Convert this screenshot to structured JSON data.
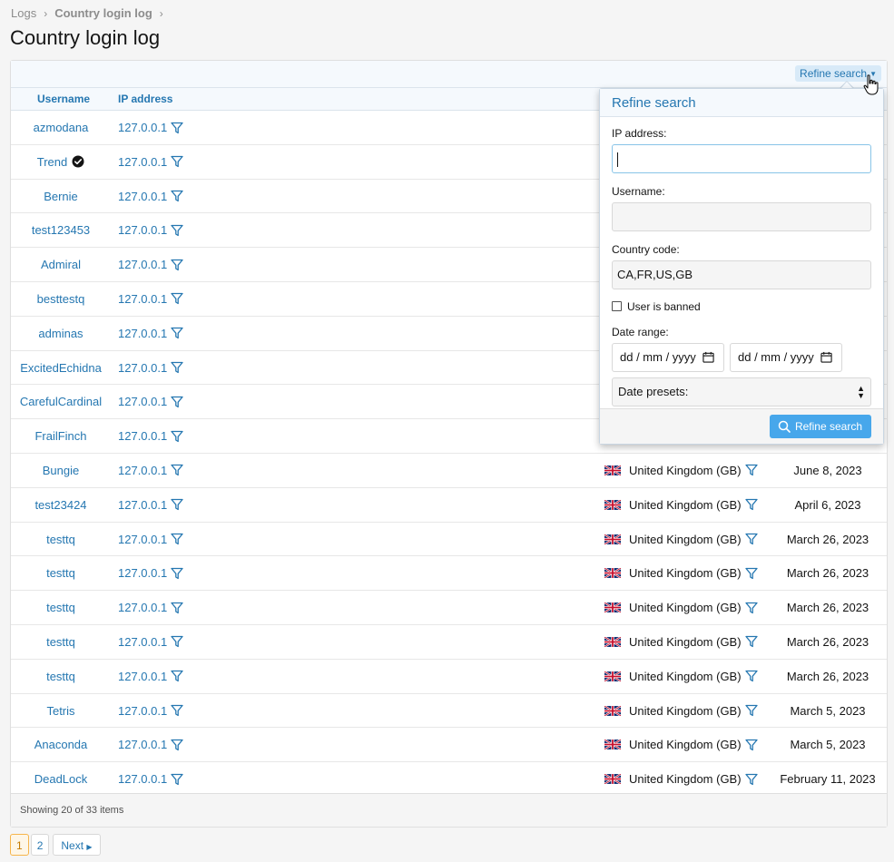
{
  "breadcrumb": {
    "items": [
      "Logs",
      "Country login log"
    ],
    "separator": "›"
  },
  "page_title": "Country login log",
  "toolbar": {
    "refine_label": "Refine search"
  },
  "table": {
    "headers": {
      "username": "Username",
      "ip": "IP address"
    },
    "rows": [
      {
        "username": "azmodana",
        "ip": "127.0.0.1",
        "country": "",
        "date": ""
      },
      {
        "username": "Trend",
        "ip": "127.0.0.1",
        "country": "",
        "date": "",
        "verified": true
      },
      {
        "username": "Bernie",
        "ip": "127.0.0.1",
        "country": "",
        "date": ""
      },
      {
        "username": "test123453",
        "ip": "127.0.0.1",
        "country": "",
        "date": ""
      },
      {
        "username": "Admiral",
        "ip": "127.0.0.1",
        "country": "",
        "date": ""
      },
      {
        "username": "besttestq",
        "ip": "127.0.0.1",
        "country": "",
        "date": ""
      },
      {
        "username": "adminas",
        "ip": "127.0.0.1",
        "country": "",
        "date": ""
      },
      {
        "username": "ExcitedEchidna",
        "ip": "127.0.0.1",
        "country": "",
        "date": ""
      },
      {
        "username": "CarefulCardinal",
        "ip": "127.0.0.1",
        "country": "",
        "date": ""
      },
      {
        "username": "FrailFinch",
        "ip": "127.0.0.1",
        "country": "",
        "date": ""
      },
      {
        "username": "Bungie",
        "ip": "127.0.0.1",
        "country": "United Kingdom (GB)",
        "date": "June 8, 2023"
      },
      {
        "username": "test23424",
        "ip": "127.0.0.1",
        "country": "United Kingdom (GB)",
        "date": "April 6, 2023"
      },
      {
        "username": "testtq",
        "ip": "127.0.0.1",
        "country": "United Kingdom (GB)",
        "date": "March 26, 2023"
      },
      {
        "username": "testtq",
        "ip": "127.0.0.1",
        "country": "United Kingdom (GB)",
        "date": "March 26, 2023"
      },
      {
        "username": "testtq",
        "ip": "127.0.0.1",
        "country": "United Kingdom (GB)",
        "date": "March 26, 2023"
      },
      {
        "username": "testtq",
        "ip": "127.0.0.1",
        "country": "United Kingdom (GB)",
        "date": "March 26, 2023"
      },
      {
        "username": "testtq",
        "ip": "127.0.0.1",
        "country": "United Kingdom (GB)",
        "date": "March 26, 2023"
      },
      {
        "username": "Tetris",
        "ip": "127.0.0.1",
        "country": "United Kingdom (GB)",
        "date": "March 5, 2023"
      },
      {
        "username": "Anaconda",
        "ip": "127.0.0.1",
        "country": "United Kingdom (GB)",
        "date": "March 5, 2023"
      },
      {
        "username": "DeadLock",
        "ip": "127.0.0.1",
        "country": "United Kingdom (GB)",
        "date": "February 11, 2023"
      }
    ]
  },
  "footer": {
    "showing": "Showing 20 of 33 items"
  },
  "pagination": {
    "pages": [
      "1",
      "2"
    ],
    "current": "1",
    "next_label": "Next"
  },
  "refine_popup": {
    "title": "Refine search",
    "ip_label": "IP address:",
    "ip_value": "",
    "username_label": "Username:",
    "username_value": "",
    "country_label": "Country code:",
    "country_value": "CA,FR,US,GB",
    "banned_label": "User is banned",
    "banned_checked": false,
    "date_range_label": "Date range:",
    "date_start_placeholder": "dd / mm / yyyy",
    "date_end_placeholder": "dd / mm / yyyy",
    "date_presets_label": "Date presets:",
    "submit_label": "Refine search"
  },
  "colors": {
    "link": "#2577b1",
    "accent": "#47a7eb",
    "current_page": "#f6b54b"
  }
}
